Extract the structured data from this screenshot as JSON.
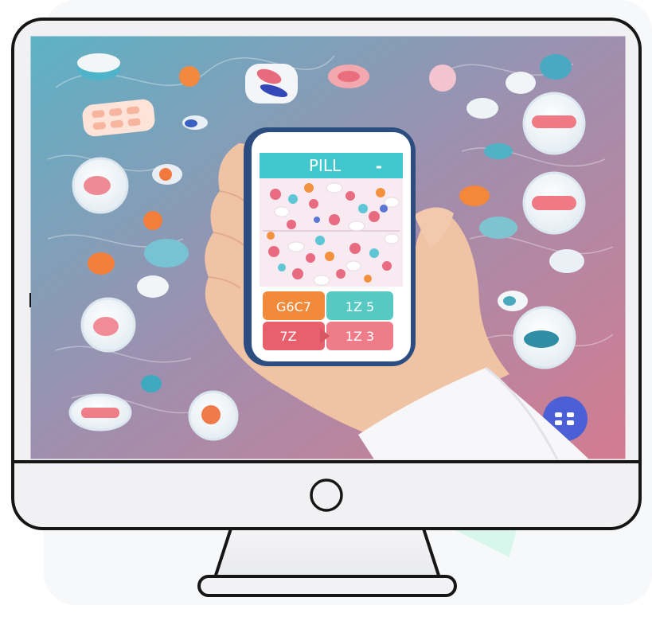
{
  "phone": {
    "title": "PILL",
    "menu_mark": "▬",
    "tile_top_left": "G6C7",
    "tile_top_right": "1Z 5",
    "tile_bottom_left": "7Z",
    "tile_bottom_right": "1Z 3"
  },
  "colors": {
    "bg_left": "#63b4c6",
    "bg_right": "#c87a92",
    "phone_header": "#41c8cf",
    "tile_orange": "#f28a3c",
    "tile_teal": "#56c9c2",
    "tile_red": "#e8606c",
    "tile_pink": "#ef7d89",
    "skin": "#f1c4a7",
    "outline": "#161616"
  }
}
